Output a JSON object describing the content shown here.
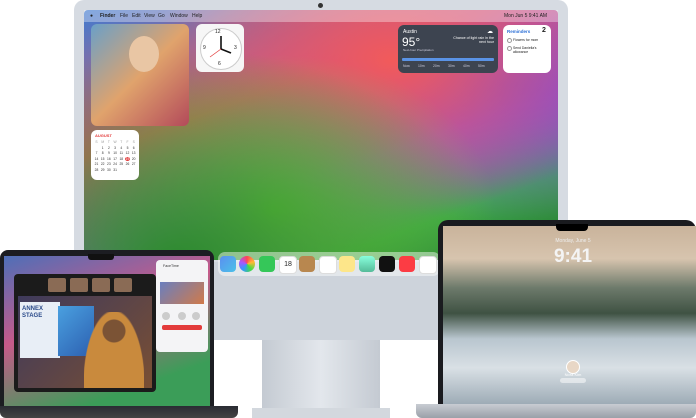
{
  "imac": {
    "menubar": {
      "apple": "",
      "items": [
        "Finder",
        "File",
        "Edit",
        "View",
        "Go",
        "Window",
        "Help"
      ],
      "right_status": "Mon Jun 5  9:41 AM"
    },
    "widgets": {
      "clock": {
        "numeral_top": "12",
        "numeral_left": "9",
        "numeral_right": "3",
        "numeral_bottom": "6"
      },
      "weather": {
        "city": "Austin",
        "temp": "95°",
        "condition": "Chance of light rain in the next hour",
        "subtext": "Next-hour Precipitation",
        "times": [
          "Now",
          "10m",
          "20m",
          "30m",
          "40m",
          "50m"
        ]
      },
      "reminders": {
        "title": "Reminders",
        "count": "2",
        "items": [
          "Flowers for mom",
          "Send Daniella's allowance"
        ]
      },
      "calendar": {
        "month": "AUGUST",
        "days_header": [
          "S",
          "M",
          "T",
          "W",
          "T",
          "F",
          "S"
        ],
        "weeks": [
          [
            "",
            "1",
            "2",
            "3",
            "4",
            "5",
            "6"
          ],
          [
            "7",
            "8",
            "9",
            "10",
            "11",
            "12",
            "13"
          ],
          [
            "14",
            "15",
            "16",
            "17",
            "18",
            "19",
            "20"
          ],
          [
            "21",
            "22",
            "23",
            "24",
            "25",
            "26",
            "27"
          ],
          [
            "28",
            "29",
            "30",
            "31",
            "",
            "",
            ""
          ]
        ],
        "today": "19"
      }
    },
    "dock_calendar_day": "18"
  },
  "left_laptop": {
    "facetime": {
      "slide_title_line1": "ANNEX",
      "slide_title_line2": "STAGE"
    },
    "panel": {
      "name": "FaceTime"
    }
  },
  "right_laptop": {
    "lock_time": "9:41",
    "lock_date": "Monday, June 5",
    "user_name": "Nora Kim"
  },
  "colors": {
    "weather_bg": "#3d4450",
    "calendar_today": "#e33b3b",
    "dock_bg": "rgba(255,255,255,0.45)"
  }
}
